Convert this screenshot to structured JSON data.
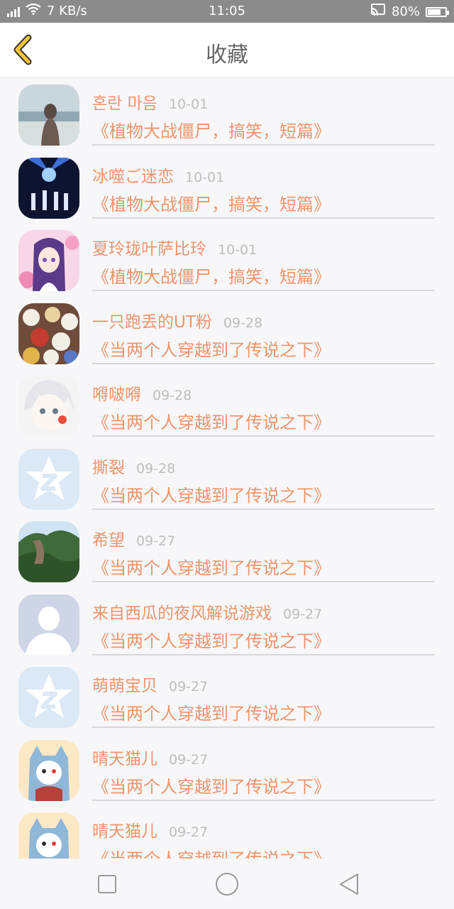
{
  "status_bar": {
    "net_speed": "7 KB/s",
    "time": "11:05",
    "battery": "80%",
    "battery_level": 0.8
  },
  "header": {
    "title": "收藏",
    "back_icon": "chevron-left-icon",
    "accent": "#f3c43a"
  },
  "favorites": [
    {
      "name": "혼란 마음",
      "date": "10-01",
      "story": "《植物大战僵尸，搞笑，短篇》",
      "avatar": "girl-sea-photo"
    },
    {
      "name": "冰噬ご迷恋",
      "date": "10-01",
      "story": "《植物大战僵尸，搞笑，短篇》",
      "avatar": "stage-light-photo"
    },
    {
      "name": "夏玲珑叶萨比玲",
      "date": "10-01",
      "story": "《植物大战僵尸，搞笑，短篇》",
      "avatar": "anime-girl-purple"
    },
    {
      "name": "一只跑丢的UT粉",
      "date": "09-28",
      "story": "《当两个人穿越到了传说之下》",
      "avatar": "skull-pile-art"
    },
    {
      "name": "嘚啵嘚",
      "date": "09-28",
      "story": "《当两个人穿越到了传说之下》",
      "avatar": "anime-boy-white"
    },
    {
      "name": "撕裂",
      "date": "09-28",
      "story": "《当两个人穿越到了传说之下》",
      "avatar": "qq-default-icon"
    },
    {
      "name": "希望",
      "date": "09-27",
      "story": "《当两个人穿越到了传说之下》",
      "avatar": "cliff-landscape-photo"
    },
    {
      "name": "来自西瓜的夜风解说游戏",
      "date": "09-27",
      "story": "《当两个人穿越到了传说之下》",
      "avatar": "default-person-icon"
    },
    {
      "name": "萌萌宝贝",
      "date": "09-27",
      "story": "《当两个人穿越到了传说之下》",
      "avatar": "qq-default-icon"
    },
    {
      "name": "晴天猫儿",
      "date": "09-27",
      "story": "《当两个人穿越到了传说之下》",
      "avatar": "cat-hood-character"
    },
    {
      "name": "晴天猫儿",
      "date": "09-27",
      "story": "《当两个人穿越到了传说之下》",
      "avatar": "cat-hood-character"
    }
  ],
  "nav_bar": {
    "icons": [
      "recent-apps-icon",
      "home-icon",
      "back-triangle-icon"
    ]
  },
  "colors": {
    "name_text": "#f0946a",
    "date_text": "#bdbdbd",
    "divider": "#d7d7d7",
    "status_bar": "#8b8b8b"
  }
}
